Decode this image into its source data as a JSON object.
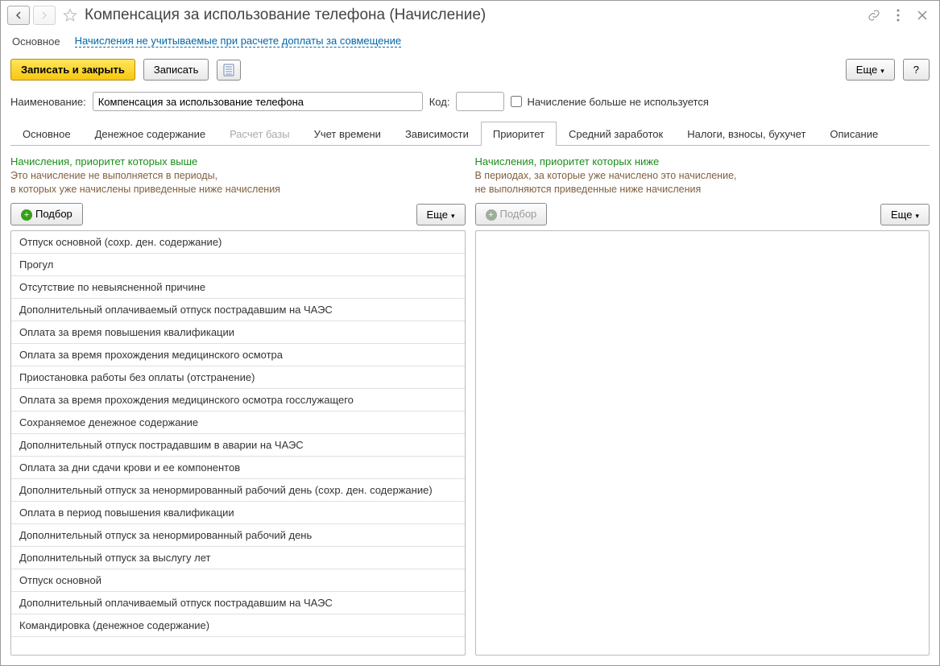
{
  "title": "Компенсация за использование телефона (Начисление)",
  "navrow": {
    "active": "Основное",
    "link": "Начисления не учитываемые при расчете доплаты за совмещение"
  },
  "buttons": {
    "save_close": "Записать и закрыть",
    "save": "Записать",
    "more": "Еще",
    "help": "?"
  },
  "form": {
    "name_label": "Наименование:",
    "name_value": "Компенсация за использование телефона",
    "code_label": "Код:",
    "code_value": "",
    "deprecated_label": "Начисление больше не используется"
  },
  "tabs": [
    {
      "label": "Основное",
      "state": "normal"
    },
    {
      "label": "Денежное содержание",
      "state": "normal"
    },
    {
      "label": "Расчет базы",
      "state": "disabled"
    },
    {
      "label": "Учет времени",
      "state": "normal"
    },
    {
      "label": "Зависимости",
      "state": "normal"
    },
    {
      "label": "Приоритет",
      "state": "active"
    },
    {
      "label": "Средний заработок",
      "state": "normal"
    },
    {
      "label": "Налоги, взносы, бухучет",
      "state": "normal"
    },
    {
      "label": "Описание",
      "state": "normal"
    }
  ],
  "priority": {
    "left": {
      "title": "Начисления, приоритет которых выше",
      "sub1": "Это начисление не выполняется в периоды,",
      "sub2": "в которых уже начислены приведенные ниже начисления",
      "pick": "Подбор",
      "more": "Еще",
      "items": [
        "Отпуск основной (сохр. ден. содержание)",
        "Прогул",
        "Отсутствие по невыясненной причине",
        "Дополнительный оплачиваемый отпуск пострадавшим на ЧАЭС",
        "Оплата за время повышения квалификации",
        "Оплата за время прохождения медицинского осмотра",
        "Приостановка работы без оплаты (отстранение)",
        "Оплата за время прохождения медицинского осмотра госслужащего",
        "Сохраняемое денежное содержание",
        "Дополнительный отпуск пострадавшим в аварии на ЧАЭС",
        "Оплата за дни сдачи крови и ее компонентов",
        "Дополнительный отпуск за ненормированный рабочий день (сохр. ден. содержание)",
        "Оплата в период повышения квалификации",
        "Дополнительный отпуск за ненормированный рабочий день",
        "Дополнительный отпуск за выслугу лет",
        "Отпуск основной",
        "Дополнительный оплачиваемый отпуск пострадавшим на ЧАЭС",
        "Командировка (денежное содержание)"
      ]
    },
    "right": {
      "title": "Начисления, приоритет которых ниже",
      "sub1": "В периодах, за которые уже начислено это начисление,",
      "sub2": "не выполняются приведенные ниже начисления",
      "pick": "Подбор",
      "more": "Еще",
      "items": []
    }
  }
}
